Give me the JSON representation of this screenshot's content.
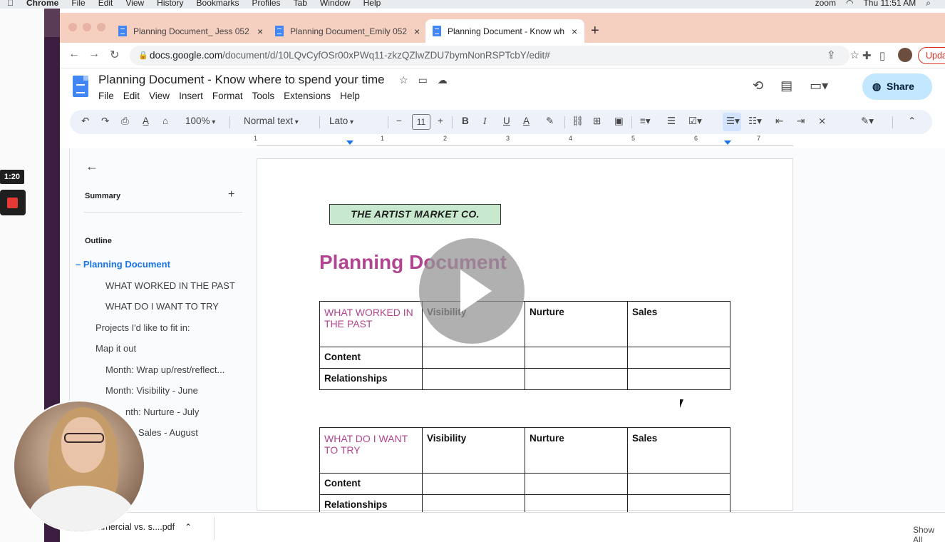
{
  "mac_menu": {
    "apple": "",
    "app": "Chrome",
    "items": [
      "File",
      "Edit",
      "View",
      "History",
      "Bookmarks",
      "Profiles",
      "Tab",
      "Window",
      "Help"
    ],
    "zoom": "zoom",
    "clock": "Thu 11:51 AM"
  },
  "recording": {
    "timer": "1:20"
  },
  "tabs": [
    {
      "label": "Planning Document_ Jess 052",
      "close": "×"
    },
    {
      "label": "Planning Document_Emily 052",
      "close": "×"
    },
    {
      "label": "Planning Document - Know wh",
      "close": "×"
    }
  ],
  "newtab": "+",
  "omnibox": {
    "domain": "docs.google.com",
    "path": "/document/d/10LQvCyfOSr00xPWq11-zkzQZlwZDU7bymNonRSPTcbY/edit#",
    "update_label": "Upda"
  },
  "docs": {
    "title": "Planning Document - Know where to spend your time",
    "menu": [
      "File",
      "Edit",
      "View",
      "Insert",
      "Format",
      "Tools",
      "Extensions",
      "Help"
    ],
    "share_label": "Share"
  },
  "toolbar": {
    "zoom": "100%",
    "style": "Normal text",
    "font": "Lato",
    "font_size": "11"
  },
  "ruler_numbers": [
    "1",
    "1",
    "2",
    "3",
    "4",
    "5",
    "6",
    "7"
  ],
  "outline": {
    "summary_label": "Summary",
    "outline_label": "Outline",
    "items": [
      {
        "text": "Planning Document",
        "level": 1,
        "active": true
      },
      {
        "text": "WHAT WORKED IN THE PAST",
        "level": 3
      },
      {
        "text": "WHAT DO I WANT TO TRY",
        "level": 3
      },
      {
        "text": "Projects I'd like to fit in:",
        "level": 2
      },
      {
        "text": "Map it out",
        "level": 2
      },
      {
        "text": "Month: Wrap up/rest/reflect...",
        "level": 3
      },
      {
        "text": "Month: Visibility - June",
        "level": 3
      },
      {
        "text": "nth: Nurture - July",
        "level": 3
      },
      {
        "text": "Sales - August",
        "level": 3
      }
    ]
  },
  "page": {
    "logo": "THE ARTIST MARKET CO.",
    "heading": "Planning Document",
    "table1": {
      "corner": "WHAT WORKED IN THE PAST",
      "columns": [
        "Visibility",
        "Nurture",
        "Sales"
      ],
      "rows": [
        "Content",
        "Relationships"
      ]
    },
    "table2": {
      "corner": "WHAT DO I WANT TO TRY",
      "columns": [
        "Visibility",
        "Nurture",
        "Sales"
      ],
      "rows": [
        "Content",
        "Relationships"
      ]
    }
  },
  "downloads": {
    "file": "Commercial vs. s....pdf",
    "show_all": "Show All"
  },
  "colors": {
    "heading_pink": "#b1458f",
    "logo_green": "#c9e9cf",
    "tab_strip": "#f5cfc0",
    "share_bg": "#c2e7ff"
  }
}
